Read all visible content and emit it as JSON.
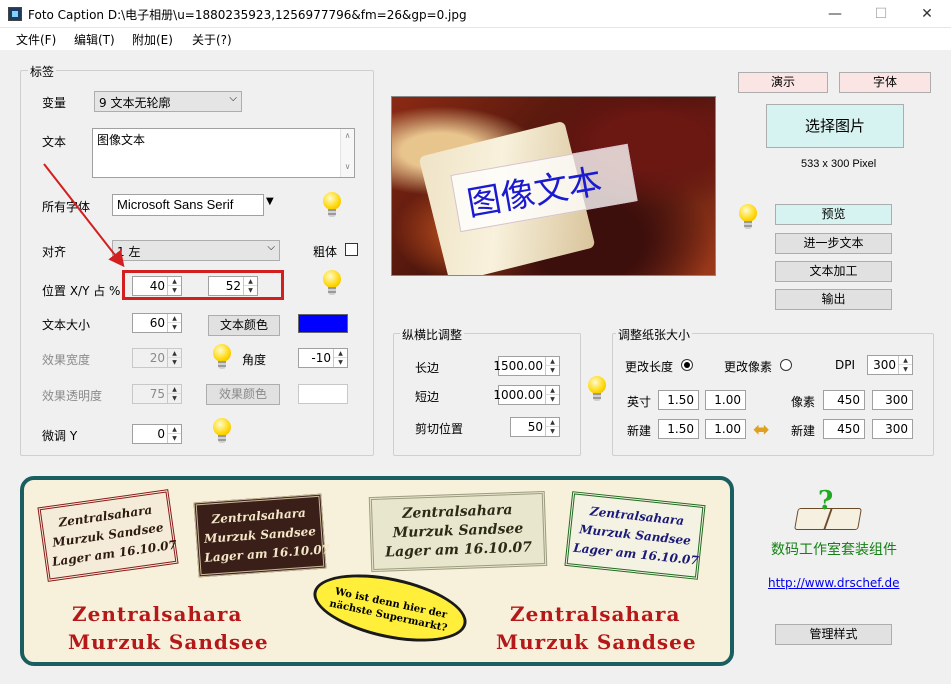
{
  "window": {
    "title": "Foto Caption D:\\电子相册\\u=1880235923,1256977796&fm=26&gp=0.jpg",
    "minimize": "—",
    "maximize": "☐",
    "close": "✕"
  },
  "menu": [
    "文件(F)",
    "编辑(T)",
    "附加(E)",
    "关于(?)"
  ],
  "label_group": {
    "title": "标签",
    "variant_label": "变量",
    "variant_value": "9 文本无轮廓",
    "text_label": "文本",
    "text_value": "图像文本",
    "font_label": "所有字体",
    "font_value": "Microsoft Sans Serif",
    "align_label": "对齐",
    "align_value": "1 左",
    "bold_label": "粗体",
    "bold_checked": false,
    "position_label": "位置 X/Y 占 %",
    "pos_x": "40",
    "pos_y": "52",
    "size_label": "文本大小",
    "size_value": "60",
    "text_color_button": "文本颜色",
    "text_color": "#0000ff",
    "effect_width_label": "效果宽度",
    "effect_width_value": "20",
    "angle_label": "角度",
    "angle_value": "-10",
    "effect_transparency_label": "效果透明度",
    "effect_transparency_value": "75",
    "effect_color_button": "效果颜色",
    "effect_color": "#ffffff",
    "fine_y_label": "微调 Y",
    "fine_y_value": "0",
    "highlight_color": "#d21f1f"
  },
  "preview": {
    "caption": "图像文本",
    "caption_color": "#1a1ad0"
  },
  "right_panel": {
    "demo_button": "演示",
    "font_button": "字体",
    "select_image_button": "选择图片",
    "image_size": "533 x 300 Pixel",
    "preview_button": "预览",
    "more_text_button": "进一步文本",
    "text_process_button": "文本加工",
    "output_button": "输出"
  },
  "aspect_group": {
    "title": "纵横比调整",
    "long_label": "长边",
    "long_value": "1500.00",
    "short_label": "短边",
    "short_value": "1000.00",
    "crop_label": "剪切位置",
    "crop_value": "50"
  },
  "paper_group": {
    "title": "调整纸张大小",
    "change_length_label": "更改长度",
    "change_length_selected": true,
    "change_pixel_label": "更改像素",
    "change_pixel_selected": false,
    "dpi_label": "DPI",
    "dpi_value": "300",
    "inch_label": "英寸",
    "inch_w": "1.50",
    "inch_h": "1.00",
    "pixel_label": "像素",
    "pixel_w": "450",
    "pixel_h": "300",
    "new_label": "新建",
    "new_inch_w": "1.50",
    "new_inch_h": "1.00",
    "new_label_2": "新建",
    "new_pixel_w": "450",
    "new_pixel_h": "300"
  },
  "banner": {
    "stamp1": [
      "Zentralsahara",
      "Murzuk Sandsee",
      "Lager am 16.10.07"
    ],
    "stamp2": [
      "Zentralsahara",
      "Murzuk Sandsee",
      "Lager am 16.10.07"
    ],
    "stamp3": [
      "Zentralsahara",
      "Murzuk Sandsee",
      "Lager am 16.10.07"
    ],
    "stamp4": [
      "Zentralsahara",
      "Murzuk Sandsee",
      "Lager am 16.10.07"
    ],
    "bubble": [
      "Wo ist denn hier der",
      "nächste Supermarkt?"
    ],
    "bottom_left": [
      "Zentralsahara",
      "Murzuk Sandsee"
    ],
    "bottom_right": [
      "Zentralsahara",
      "Murzuk Sandsee"
    ]
  },
  "footer": {
    "product_name": "数码工作室套装组件",
    "url": "http://www.drschef.de",
    "manage_styles_button": "管理样式"
  }
}
